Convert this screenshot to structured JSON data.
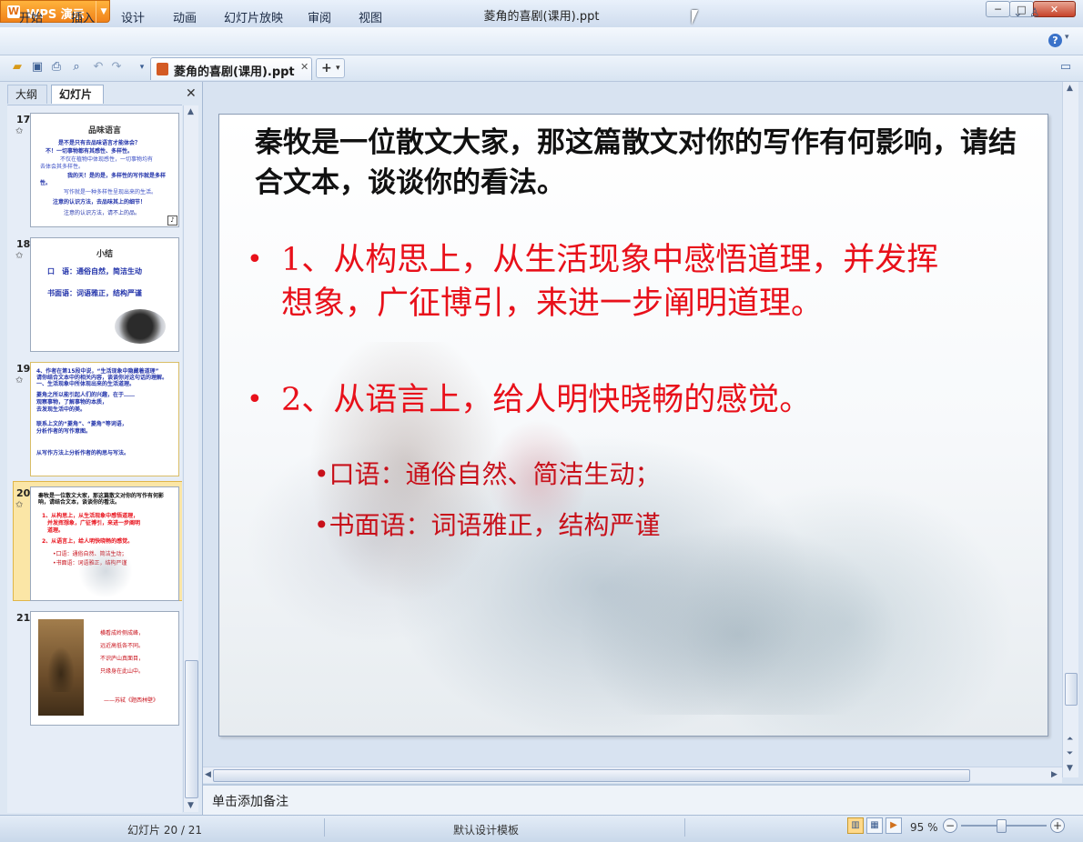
{
  "window": {
    "app_label": "WPS 演示",
    "doc_title": "菱角的喜剧(课用).ppt",
    "minimize": "─",
    "maximize": "□",
    "close": "✕"
  },
  "menu": {
    "items": [
      "开始",
      "插入",
      "设计",
      "动画",
      "幻灯片放映",
      "审阅",
      "视图"
    ],
    "icons": [
      "chevron-down-icon",
      "skin-icon",
      "help-icon"
    ]
  },
  "toolbar": {
    "icons": [
      "open-folder-icon",
      "save-icon",
      "print-icon",
      "print-preview-icon",
      "undo-icon",
      "redo-icon",
      "customize-icon"
    ],
    "doc_tab_label": "菱角的喜剧(课用).ppt",
    "new_tab": "+"
  },
  "left_pane": {
    "tabs": [
      "大纲",
      "幻灯片"
    ],
    "active_tab": "幻灯片",
    "slides": [
      {
        "number": "17",
        "title": "品味语言",
        "lines": [
          "是不是只有去品味语言才能体会？",
          "不！一切事物都有其感性、多样性。",
          "不仅在植物中体现感性，一切事物均有",
          "去体会其多样性。",
          "我的天！是的是，多样性的写作就是多样",
          "性。",
          "写作就是一种多样性呈现出来的生活。",
          "注意的认识方法，去品味其上的细节！",
          "注意的认识方法，请不上的品。"
        ]
      },
      {
        "number": "18",
        "title": "小结",
        "lines": [
          "口　语：通俗自然，简洁生动",
          "书面语：词语雅正，结构严谨"
        ]
      },
      {
        "number": "19",
        "title": "",
        "lines": [
          "4、作者在第15段中说，“生活现象中隐藏着道理”",
          "请你结合文本中的相关内容，谈谈你对这句话的理解。",
          "一、生活现象中所体现出来的生活道理。",
          "菱角之所以能引起人们的兴趣，在于……",
          "观察事物，了解事物的本质，",
          "去发现生活中的美。",
          "联系上文的“菱角”、“菱角”等词语，",
          "分析作者的写作意图。",
          "从写作方法上分析作者的构思与写法。"
        ]
      },
      {
        "number": "20",
        "title": "",
        "lines": [
          "秦牧是一位散文大家，那这篇散文对你的写作有何影",
          "响，请结合文本，谈谈你的看法。",
          "1、从构思上，从生活现象中感悟道理，",
          "并发挥想象，广征博引，来进一步阐明",
          "道理。",
          "2、从语言上，给人明快晓畅的感觉。",
          "•口语：通俗自然、简洁生动；",
          "•书面语：词语雅正，结构严谨"
        ]
      },
      {
        "number": "21",
        "title": "",
        "lines": [
          "横看成岭侧成峰，",
          "远近高低各不同。",
          "不识庐山真面目，",
          "只缘身在此山中。",
          "——苏轼《题西林壁》"
        ]
      }
    ]
  },
  "slide": {
    "title": "秦牧是一位散文大家，那这篇散文对你的写作有何影响，请结合文本，谈谈你的看法。",
    "bullets": [
      {
        "marker": "•",
        "text": "1、从构思上，从生活现象中感悟道理，并发挥想象，广征博引，来进一步阐明道理。"
      },
      {
        "marker": "•",
        "text": "2、从语言上，给人明快晓畅的感觉。"
      }
    ],
    "sub_points": [
      "•口语：通俗自然、简洁生动；",
      "•书面语：词语雅正，结构严谨"
    ]
  },
  "notes": {
    "placeholder": "单击添加备注"
  },
  "status": {
    "slide_indicator": "幻灯片 20 / 21",
    "design": "默认设计模板",
    "zoom": "95 %",
    "zoom_level": 0.95
  },
  "colors": {
    "accent_red": "#e8101a",
    "sub_red": "#c8101a",
    "selected_thumb": "#fbe6a6",
    "app_orange": "#f0821a"
  }
}
